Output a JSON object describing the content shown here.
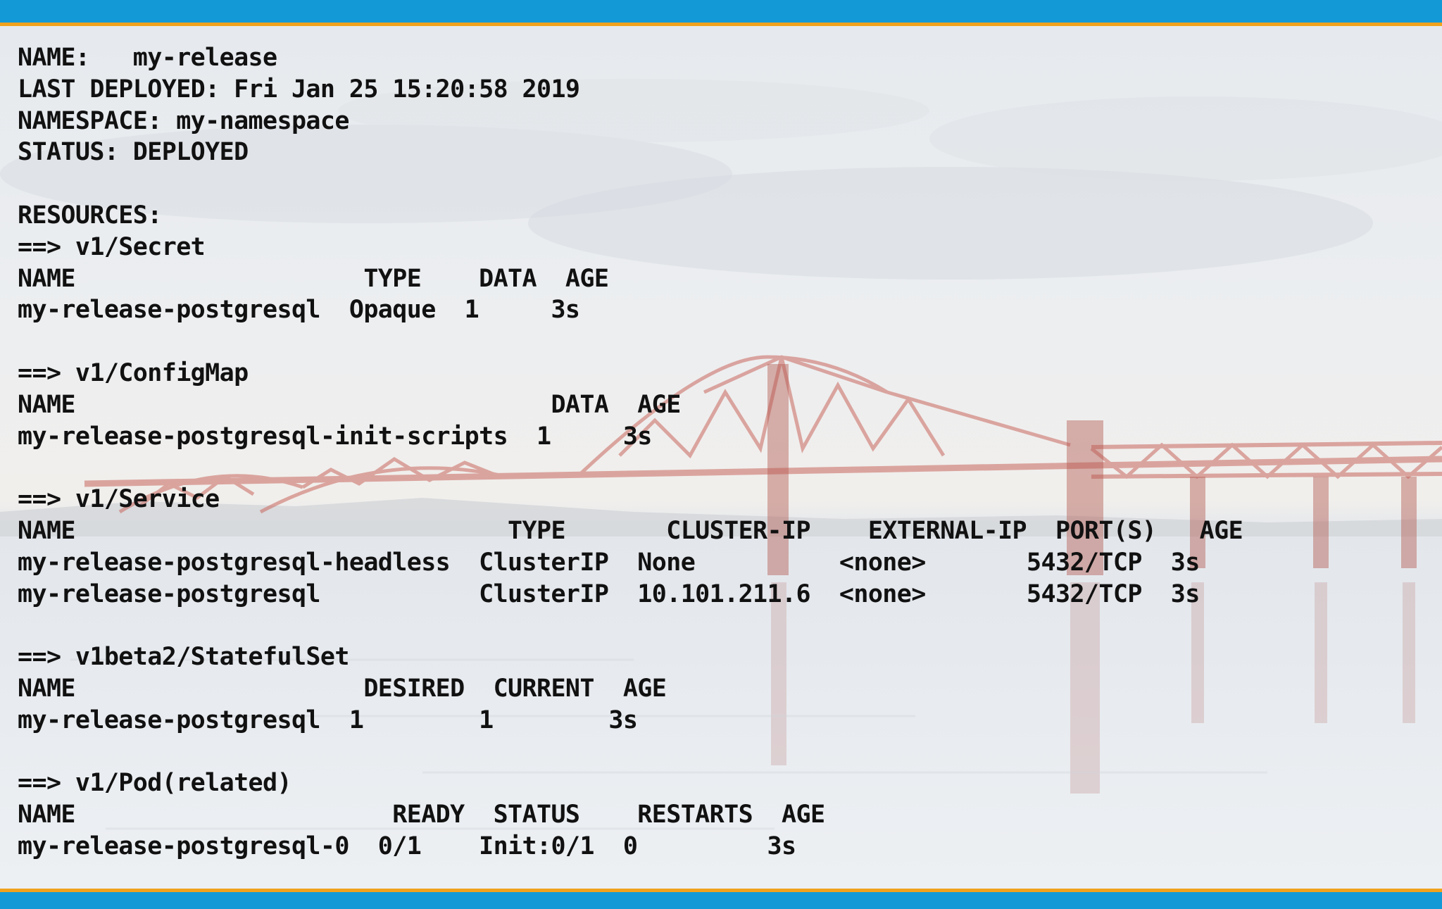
{
  "terminal": {
    "lines": [
      "NAME:   my-release",
      "LAST DEPLOYED: Fri Jan 25 15:20:58 2019",
      "NAMESPACE: my-namespace",
      "STATUS: DEPLOYED",
      "",
      "RESOURCES:",
      "==> v1/Secret",
      "NAME                    TYPE    DATA  AGE",
      "my-release-postgresql  Opaque  1     3s",
      "",
      "==> v1/ConfigMap",
      "NAME                                 DATA  AGE",
      "my-release-postgresql-init-scripts  1     3s",
      "",
      "==> v1/Service",
      "NAME                              TYPE       CLUSTER-IP    EXTERNAL-IP  PORT(S)   AGE",
      "my-release-postgresql-headless  ClusterIP  None          <none>       5432/TCP  3s",
      "my-release-postgresql           ClusterIP  10.101.211.6  <none>       5432/TCP  3s",
      "",
      "==> v1beta2/StatefulSet",
      "NAME                    DESIRED  CURRENT  AGE",
      "my-release-postgresql  1        1        3s",
      "",
      "==> v1/Pod(related)",
      "NAME                      READY  STATUS    RESTARTS  AGE",
      "my-release-postgresql-0  0/1    Init:0/1  0         3s"
    ]
  },
  "colors": {
    "accent_bar": "#139ad6",
    "accent_edge": "#f0a21c",
    "text": "#111111"
  }
}
